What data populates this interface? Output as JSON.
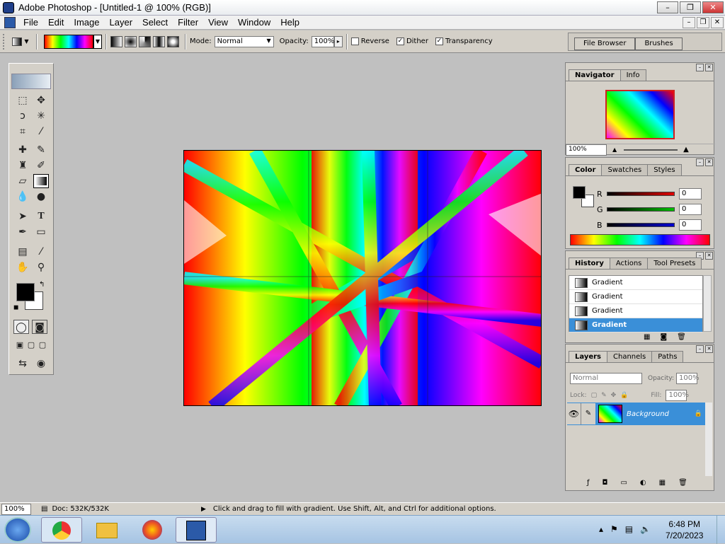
{
  "window": {
    "title": "Adobe Photoshop - [Untitled-1 @ 100% (RGB)]",
    "min": "–",
    "max": "❐",
    "close": "✕"
  },
  "menu": [
    "File",
    "Edit",
    "Image",
    "Layer",
    "Select",
    "Filter",
    "View",
    "Window",
    "Help"
  ],
  "options": {
    "mode_label": "Mode:",
    "mode_value": "Normal",
    "opacity_label": "Opacity:",
    "opacity_value": "100%",
    "reverse": "Reverse",
    "dither": "Dither",
    "transparency": "Transparency",
    "file_browser": "File Browser",
    "brushes": "Brushes"
  },
  "navigator": {
    "tabs": [
      "Navigator",
      "Info"
    ],
    "zoom": "100%"
  },
  "color": {
    "tabs": [
      "Color",
      "Swatches",
      "Styles"
    ],
    "channels": [
      {
        "label": "R",
        "value": "0",
        "color": "#e00000"
      },
      {
        "label": "G",
        "value": "0",
        "color": "#00b000"
      },
      {
        "label": "B",
        "value": "0",
        "color": "#0000d0"
      }
    ]
  },
  "history": {
    "tabs": [
      "History",
      "Actions",
      "Tool Presets"
    ],
    "items": [
      "Gradient",
      "Gradient",
      "Gradient",
      "Gradient"
    ]
  },
  "layers": {
    "tabs": [
      "Layers",
      "Channels",
      "Paths"
    ],
    "blend": "Normal",
    "opacity_label": "Opacity:",
    "opacity_value": "100%",
    "lock_label": "Lock:",
    "fill_label": "Fill:",
    "fill_value": "100%",
    "layer_name": "Background"
  },
  "status": {
    "zoom": "100%",
    "doc": "Doc: 532K/532K",
    "hint": "Click and drag to fill with gradient.  Use Shift, Alt, and Ctrl for additional options."
  },
  "taskbar": {
    "time": "6:48 PM",
    "date": "7/20/2023"
  },
  "colors": {
    "selection": "#3a8fd8",
    "panel": "#d4d0c8",
    "workspace": "#c0c0c0"
  }
}
